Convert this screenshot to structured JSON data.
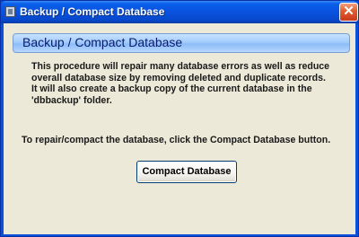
{
  "window": {
    "title": "Backup / Compact Database",
    "close_glyph": "✕"
  },
  "header": {
    "title": "Backup / Compact Database"
  },
  "description": {
    "lines": [
      "This procedure will repair many database errors as well as reduce",
      "overall database size by removing deleted and duplicate records.",
      "It will also create a backup copy of the current database in the",
      "'dbbackup' folder."
    ]
  },
  "instruction": "To repair/compact the database, click the Compact Database button.",
  "actions": {
    "compact_label": "Compact Database"
  },
  "colors": {
    "titlebar": "#0a52df",
    "client_bg": "#ece9d8",
    "header_band": "#a3ccfb",
    "close_button": "#e25a2e"
  },
  "icons": [
    "app-database-icon",
    "close-icon"
  ]
}
